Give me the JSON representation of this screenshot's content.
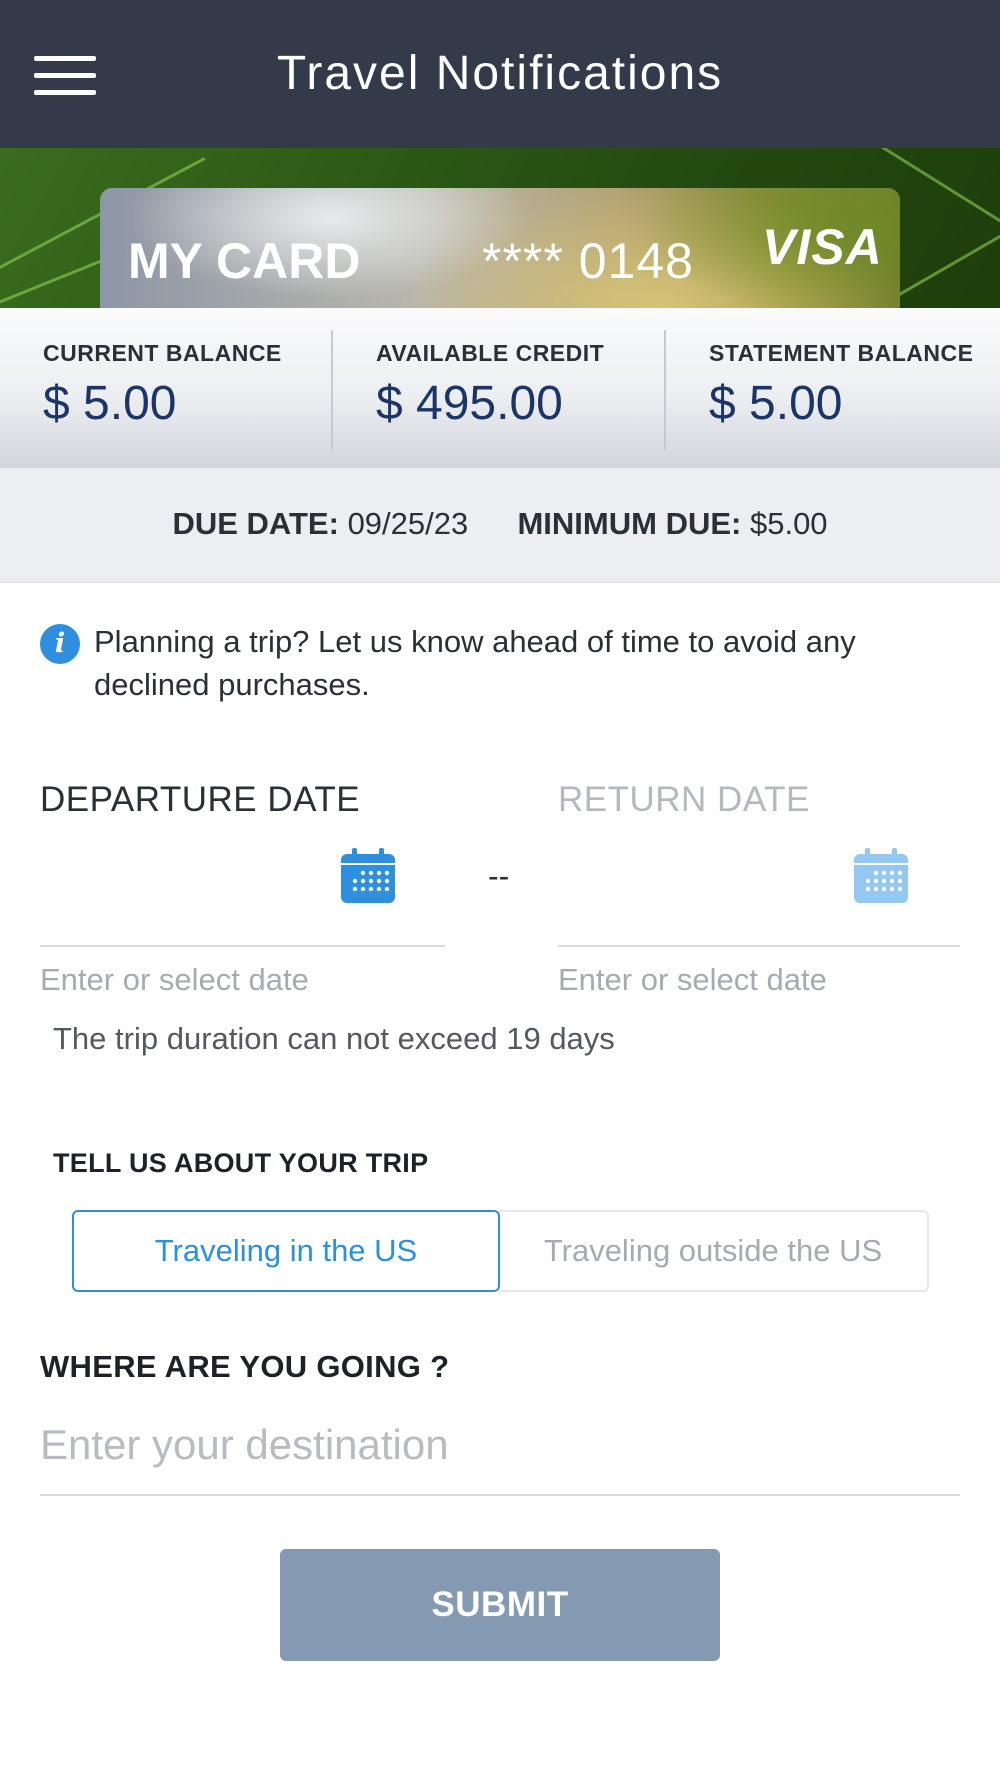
{
  "header": {
    "title": "Travel Notifications"
  },
  "card": {
    "name": "MY CARD",
    "number_masked": "**** 0148",
    "network": "VISA"
  },
  "balances": [
    {
      "label": "CURRENT BALANCE",
      "value": "$ 5.00"
    },
    {
      "label": "AVAILABLE CREDIT",
      "value": "$ 495.00"
    },
    {
      "label": "STATEMENT BALANCE",
      "value": "$ 5.00"
    }
  ],
  "due": {
    "due_date_label": "DUE DATE:",
    "due_date_value": "09/25/23",
    "minimum_due_label": "MINIMUM DUE:",
    "minimum_due_value": "$5.00"
  },
  "info": {
    "message": "Planning a trip? Let us know ahead of time to avoid any declined purchases."
  },
  "dates": {
    "departure_label": "DEPARTURE DATE",
    "return_label": "RETURN DATE",
    "separator": "--",
    "departure_hint": "Enter or select date",
    "return_hint": "Enter or select date",
    "duration_note": "The trip duration can not exceed 19 days"
  },
  "trip": {
    "section_label": "TELL US ABOUT YOUR TRIP",
    "options": [
      "Traveling in the US",
      "Traveling outside the US"
    ],
    "selected": "Traveling in the US"
  },
  "destination": {
    "label": "WHERE ARE YOU GOING ?",
    "placeholder": "Enter your destination",
    "value": ""
  },
  "submit": {
    "label": "SUBMIT"
  },
  "icons": {
    "menu": "hamburger-menu-icon",
    "info": "info-icon",
    "calendar": "calendar-icon"
  },
  "colors": {
    "header_bg": "#333a4a",
    "accent_blue": "#2e8fde",
    "balance_value": "#1b3566",
    "submit_bg": "#8499b2"
  }
}
